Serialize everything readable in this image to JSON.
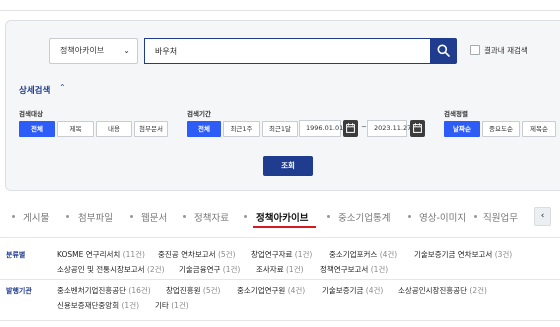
{
  "search": {
    "scope": "정책아카이브",
    "query": "바우처",
    "within_label": "결과내 재검색"
  },
  "advanced": {
    "title": "상세검색",
    "target": {
      "label": "검색대상",
      "options": [
        "전체",
        "제목",
        "내용",
        "첨부문서"
      ],
      "selected": "전체"
    },
    "period": {
      "label": "검색기간",
      "options": [
        "전체",
        "최근1주",
        "최근1달"
      ],
      "selected": "전체",
      "start": "1996.01.01",
      "end": "2023.11.27",
      "tilde": "~"
    },
    "sort": {
      "label": "검색정렬",
      "options": [
        "날짜순",
        "중요도순",
        "제목순"
      ],
      "selected": "날짜순"
    },
    "submit": "조회"
  },
  "tabs": {
    "items": [
      "게시물",
      "첨부파일",
      "웹문서",
      "정책자료",
      "정책아카이브",
      "중소기업통계",
      "영상-이미지",
      "직원업무"
    ],
    "active": "정책아카이브",
    "prev": "‹"
  },
  "facets": {
    "category": {
      "label": "분류별",
      "items": [
        {
          "name": "KOSME 연구리서치",
          "count": "(11건)"
        },
        {
          "name": "중진공 연차보고서",
          "count": "(5건)"
        },
        {
          "name": "창업연구자료",
          "count": "(1건)"
        },
        {
          "name": "중소기업포커스",
          "count": "(4건)"
        },
        {
          "name": "기술보증기금 연차보고서",
          "count": "(3건)"
        },
        {
          "name": "소상공인 및 전통시장보고서",
          "count": "(2건)"
        },
        {
          "name": "기술금융연구",
          "count": "(1건)"
        },
        {
          "name": "조사자료",
          "count": "(1건)"
        },
        {
          "name": "정책연구보고서",
          "count": "(1건)"
        }
      ]
    },
    "publisher": {
      "label": "발행기관",
      "items": [
        {
          "name": "중소벤처기업진흥공단",
          "count": "(16건)"
        },
        {
          "name": "창업진흥원",
          "count": "(5건)"
        },
        {
          "name": "중소기업연구원",
          "count": "(4건)"
        },
        {
          "name": "기술보증기금",
          "count": "(4건)"
        },
        {
          "name": "소상공인시장진흥공단",
          "count": "(2건)"
        },
        {
          "name": "신용보증재단중앙회",
          "count": "(1건)"
        },
        {
          "name": "기타",
          "count": "(1건)"
        }
      ]
    }
  },
  "colors": {
    "accent": "#1f3c8f",
    "selected": "#2e5cf6",
    "tab_underline": "#d71920"
  }
}
